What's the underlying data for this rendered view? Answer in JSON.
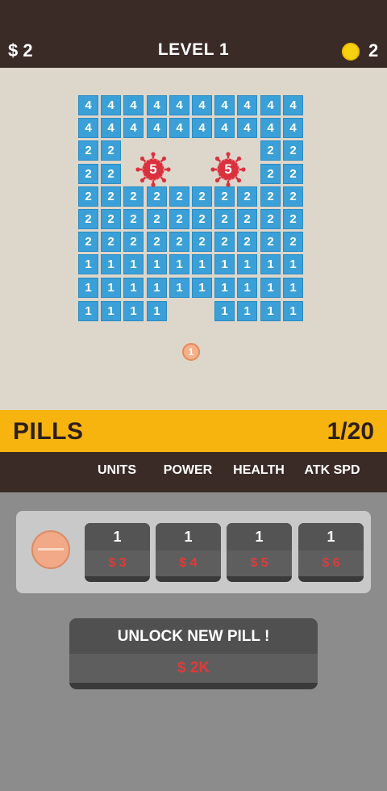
{
  "header": {
    "money": "$ 2",
    "level": "LEVEL 1",
    "coins": "2"
  },
  "board": {
    "columns": 10,
    "tile_color": "#3aa0d7",
    "rows": [
      [
        "4",
        "4",
        "4",
        "4",
        "4",
        "4",
        "4",
        "4",
        "4",
        "4"
      ],
      [
        "4",
        "4",
        "4",
        "4",
        "4",
        "4",
        "4",
        "4",
        "4",
        "4"
      ],
      [
        "2",
        "2",
        "",
        "",
        "",
        "",
        "",
        "",
        "2",
        "2"
      ],
      [
        "2",
        "2",
        "",
        "",
        "",
        "",
        "",
        "",
        "2",
        "2"
      ],
      [
        "2",
        "2",
        "2",
        "2",
        "2",
        "2",
        "2",
        "2",
        "2",
        "2"
      ],
      [
        "2",
        "2",
        "2",
        "2",
        "2",
        "2",
        "2",
        "2",
        "2",
        "2"
      ],
      [
        "2",
        "2",
        "2",
        "2",
        "2",
        "2",
        "2",
        "2",
        "2",
        "2"
      ],
      [
        "1",
        "1",
        "1",
        "1",
        "1",
        "1",
        "1",
        "1",
        "1",
        "1"
      ],
      [
        "1",
        "1",
        "1",
        "1",
        "1",
        "1",
        "1",
        "1",
        "1",
        "1"
      ],
      [
        "1",
        "1",
        "1",
        "1",
        "",
        "",
        "1",
        "1",
        "1",
        "1"
      ]
    ],
    "viruses": [
      {
        "value": "5",
        "color": "#d9323e"
      },
      {
        "value": "5",
        "color": "#d9323e"
      }
    ],
    "pill_projectile": "1"
  },
  "pills_bar": {
    "label": "PILLS",
    "count": "1/20",
    "color": "#f7b40f"
  },
  "stats_headers": [
    "UNITS",
    "POWER",
    "HEALTH",
    "ATK SPD"
  ],
  "upgrades": [
    {
      "level": "1",
      "price": "$ 3"
    },
    {
      "level": "1",
      "price": "$ 4"
    },
    {
      "level": "1",
      "price": "$ 5"
    },
    {
      "level": "1",
      "price": "$ 6"
    }
  ],
  "unlock": {
    "label": "UNLOCK NEW PILL !",
    "price": "$ 2K"
  },
  "colors": {
    "dark_bar": "#3a2b27",
    "price_red": "#e23a3a",
    "coin": "#f5d20d"
  }
}
